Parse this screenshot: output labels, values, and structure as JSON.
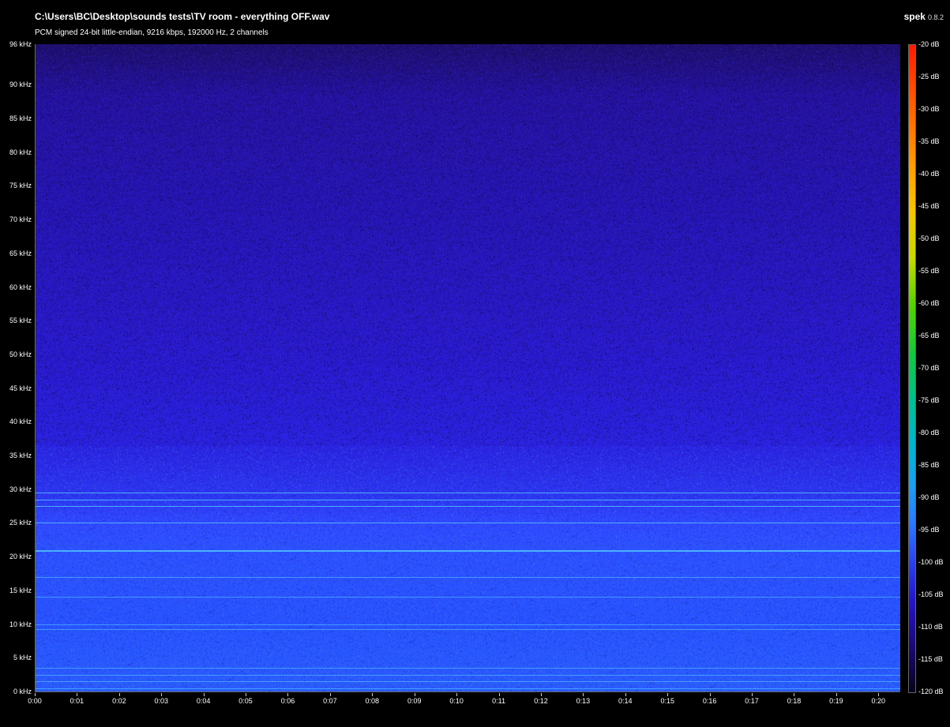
{
  "header": {
    "file_path": "C:\\Users\\BC\\Desktop\\sounds tests\\TV room - everything OFF.wav",
    "stream_info": "PCM signed 24-bit little-endian, 9216 kbps, 192000 Hz, 2 channels",
    "app_name": "spek",
    "app_version": "0.8.2"
  },
  "frequency_axis": {
    "labels": [
      "96 kHz",
      "90 kHz",
      "85 kHz",
      "80 kHz",
      "75 kHz",
      "70 kHz",
      "65 kHz",
      "60 kHz",
      "55 kHz",
      "50 kHz",
      "45 kHz",
      "40 kHz",
      "35 kHz",
      "30 kHz",
      "25 kHz",
      "20 kHz",
      "15 kHz",
      "10 kHz",
      "5 kHz",
      "0 kHz"
    ],
    "values_khz": [
      96,
      90,
      85,
      80,
      75,
      70,
      65,
      60,
      55,
      50,
      45,
      40,
      35,
      30,
      25,
      20,
      15,
      10,
      5,
      0
    ],
    "max_khz": 96
  },
  "time_axis": {
    "labels": [
      "0:00",
      "0:01",
      "0:02",
      "0:03",
      "0:04",
      "0:05",
      "0:06",
      "0:07",
      "0:08",
      "0:09",
      "0:10",
      "0:11",
      "0:12",
      "0:13",
      "0:14",
      "0:15",
      "0:16",
      "0:17",
      "0:18",
      "0:19",
      "0:20"
    ],
    "values_s": [
      0,
      1,
      2,
      3,
      4,
      5,
      6,
      7,
      8,
      9,
      10,
      11,
      12,
      13,
      14,
      15,
      16,
      17,
      18,
      19,
      20
    ],
    "max_s": 20.5
  },
  "db_scale": {
    "labels": [
      "-20 dB",
      "-25 dB",
      "-30 dB",
      "-35 dB",
      "-40 dB",
      "-45 dB",
      "-50 dB",
      "-55 dB",
      "-60 dB",
      "-65 dB",
      "-70 dB",
      "-75 dB",
      "-80 dB",
      "-85 dB",
      "-90 dB",
      "-95 dB",
      "-100 dB",
      "-105 dB",
      "-110 dB",
      "-115 dB",
      "-120 dB"
    ],
    "values_db": [
      -20,
      -25,
      -30,
      -35,
      -40,
      -45,
      -50,
      -55,
      -60,
      -65,
      -70,
      -75,
      -80,
      -85,
      -90,
      -95,
      -100,
      -105,
      -110,
      -115,
      -120
    ],
    "min_db": -120,
    "max_db": -20
  },
  "spectral_lines_khz": [
    0.5,
    1.5,
    2.5,
    3.5,
    9.2,
    10,
    14,
    17,
    21,
    25,
    27.5,
    28.5,
    29.5
  ],
  "colors": {
    "background": "#000000",
    "line": "#55c8ff"
  }
}
